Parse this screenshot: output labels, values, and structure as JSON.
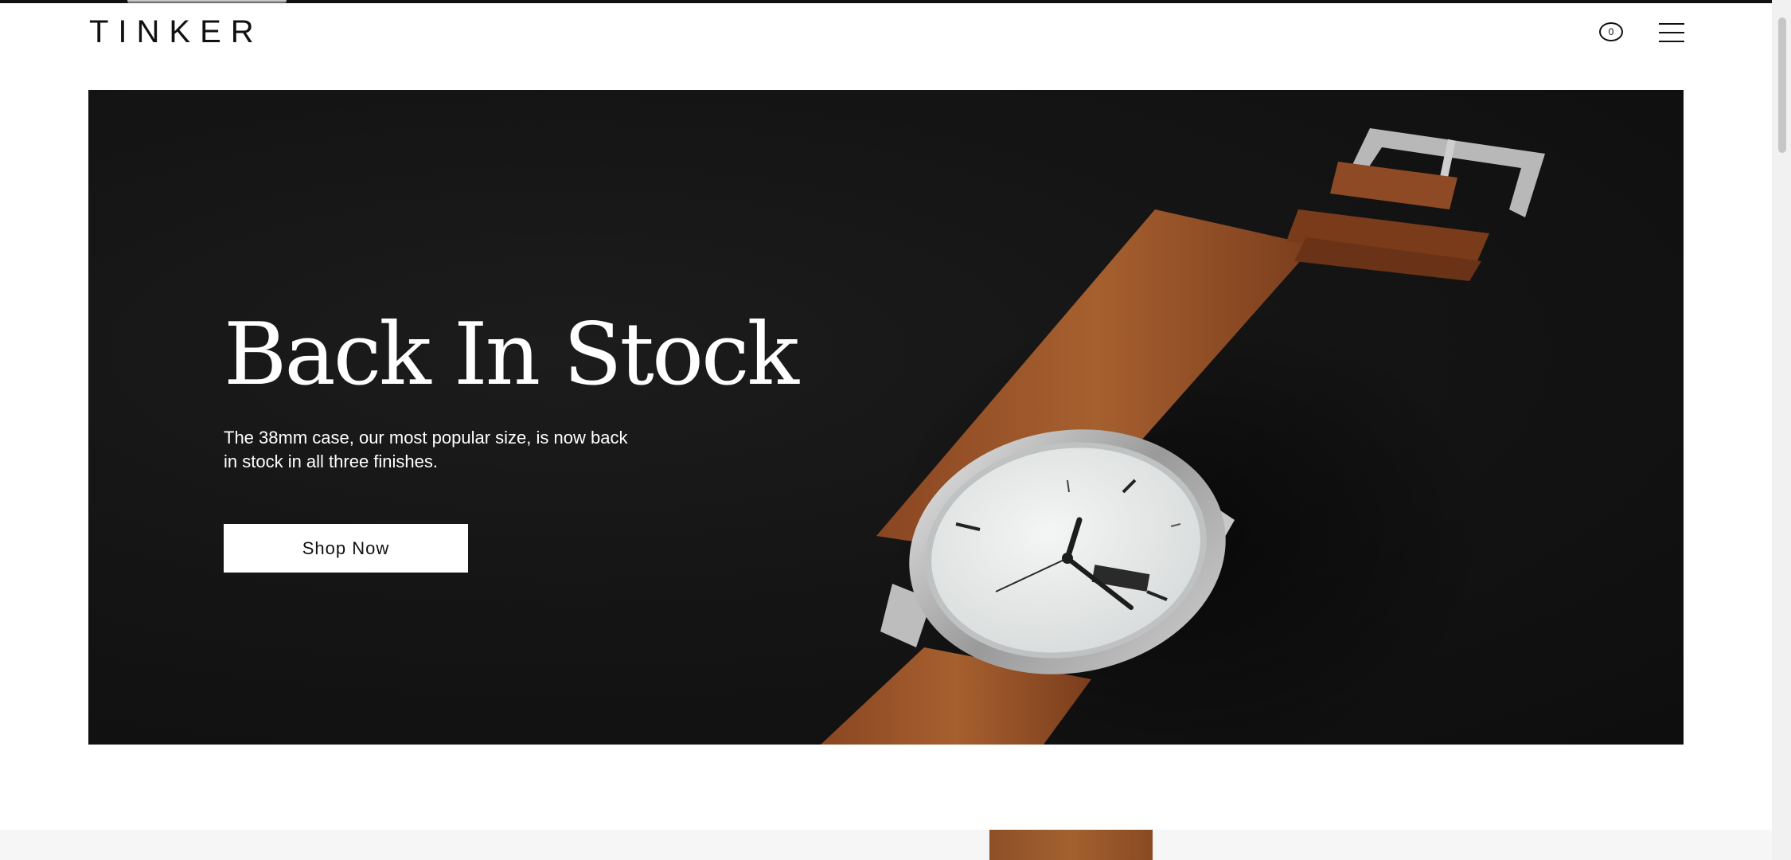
{
  "header": {
    "logo": "TINKER",
    "cart_count": "0"
  },
  "hero": {
    "title": "Back In Stock",
    "subtitle": "The 38mm case, our most popular size, is now back in stock in all three finishes.",
    "cta_label": "Shop Now"
  },
  "icons": {
    "cart": "cart-icon",
    "menu": "hamburger-menu-icon"
  },
  "colors": {
    "hero_background": "#141414",
    "strap": "#a05a2c",
    "text_dark": "#111111",
    "text_light": "#ffffff"
  }
}
